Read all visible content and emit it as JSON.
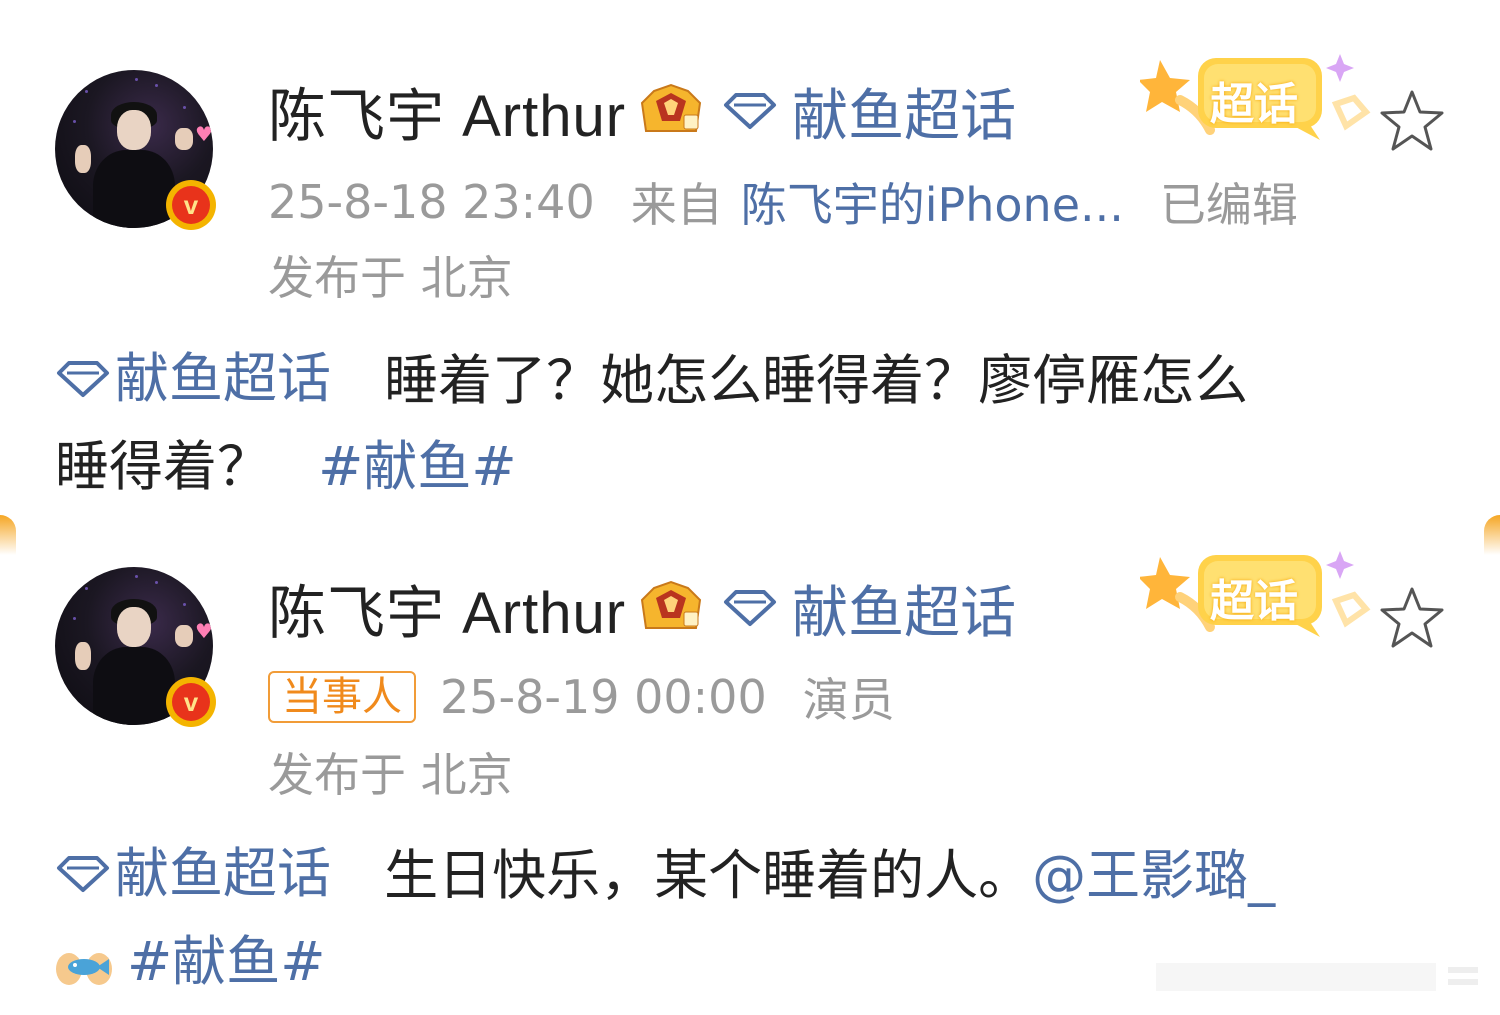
{
  "posts": [
    {
      "username": "陈飞宇 Arthur",
      "topic": "献鱼超话",
      "badge_label": "超话",
      "timestamp": "25-8-18 23:40",
      "source_prefix": "来自",
      "source": "陈飞宇的iPhone...",
      "edited": "已编辑",
      "location": "发布于 北京",
      "content": {
        "topic": "献鱼超话",
        "line1": "睡着了？她怎么睡得着？廖停雁怎么",
        "line2": "睡得着？",
        "hashtag": "#献鱼#"
      }
    },
    {
      "username": "陈飞宇 Arthur",
      "topic": "献鱼超话",
      "badge_label": "超话",
      "party_tag": "当事人",
      "timestamp": "25-8-19 00:00",
      "role": "演员",
      "location": "发布于 北京",
      "content": {
        "topic": "献鱼超话",
        "text": "生日快乐，某个睡着的人。",
        "mention": "@王影璐_",
        "hashtag": "#献鱼#"
      }
    }
  ],
  "colors": {
    "link_blue": "#4e6fa6",
    "meta_gray": "#9a9a9a",
    "party_orange": "#f08a1c",
    "verified_red": "#e8331b",
    "verified_gold": "#f4b400"
  },
  "icons": [
    "verified-v-icon",
    "crown-level-icon",
    "diamond-topic-icon",
    "chaohua-badge-icon",
    "star-favorite-icon",
    "hands-fish-emoji"
  ]
}
